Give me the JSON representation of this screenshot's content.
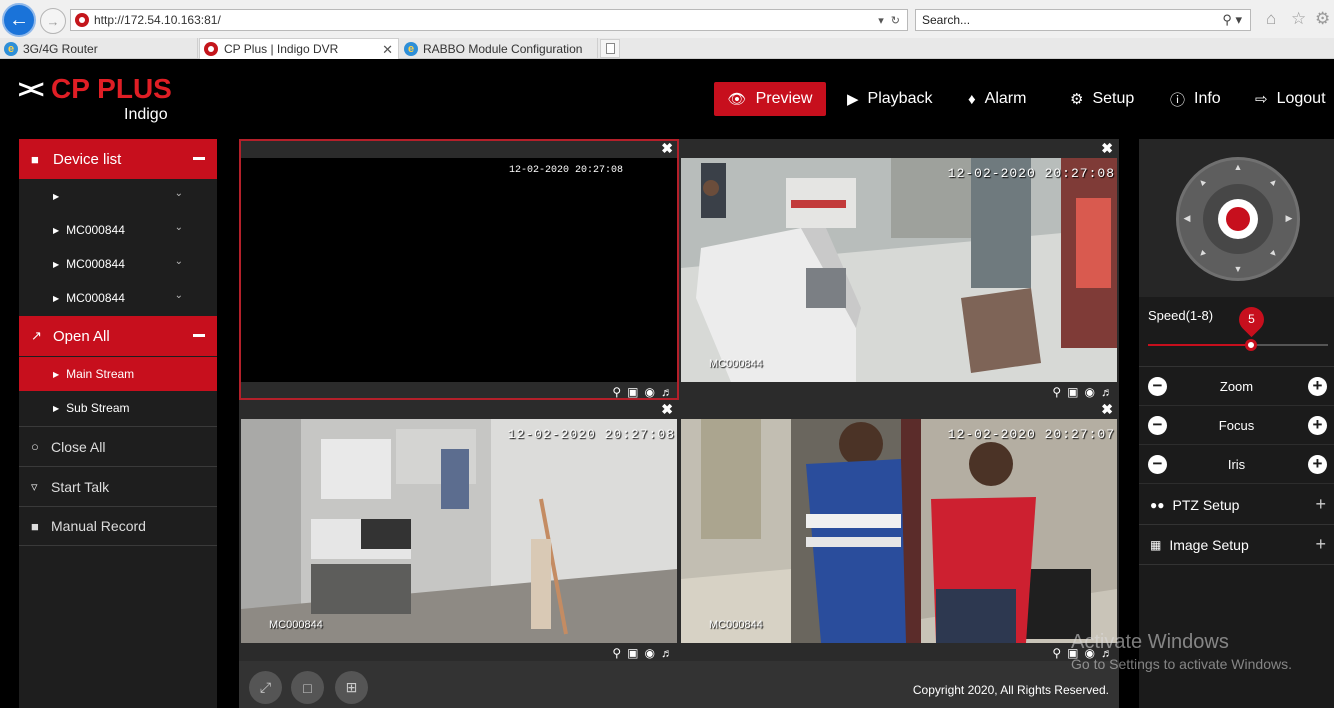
{
  "browser": {
    "url": "http://172.54.10.163:81/",
    "search_placeholder": "Search...",
    "tabs": [
      {
        "label": "3G/4G Router"
      },
      {
        "label": "CP Plus | Indigo DVR"
      },
      {
        "label": "RABBO Module Configuration"
      }
    ]
  },
  "brand": {
    "name": "CP PLUS",
    "product": "Indigo",
    "accent_color": "#c70f1d"
  },
  "nav": {
    "preview": "Preview",
    "playback": "Playback",
    "alarm": "Alarm",
    "setup": "Setup",
    "info": "Info",
    "logout": "Logout"
  },
  "left_panel": {
    "device_list_title": "Device list",
    "devices": [
      {
        "label": ""
      },
      {
        "label": "MC000844"
      },
      {
        "label": "MC000844"
      },
      {
        "label": "MC000844"
      }
    ],
    "open_all_title": "Open All",
    "streams": [
      {
        "label": "Main Stream",
        "selected": true
      },
      {
        "label": "Sub Stream",
        "selected": false
      }
    ],
    "close_all": "Close All",
    "start_talk": "Start Talk",
    "manual_record": "Manual Record"
  },
  "cameras": [
    {
      "timestamp": "12-02-2020 20:27:08",
      "name": ""
    },
    {
      "timestamp": "12-02-2020 20:27:08",
      "name": "MC000844"
    },
    {
      "timestamp": "12-02-2020 20:27:08",
      "name": "MC000844"
    },
    {
      "timestamp": "12-02-2020 20:27:07",
      "name": "MC000844"
    }
  ],
  "footer": {
    "copyright": "Copyright 2020, All Rights Reserved."
  },
  "ptz": {
    "speed_label": "Speed(1-8)",
    "speed_value": "5",
    "speed_min": 1,
    "speed_max": 8,
    "zoom": "Zoom",
    "focus": "Focus",
    "iris": "Iris",
    "ptz_setup": "PTZ Setup",
    "image_setup": "Image Setup"
  },
  "watermark": {
    "line1": "Activate Windows",
    "line2": "Go to Settings to activate Windows."
  }
}
